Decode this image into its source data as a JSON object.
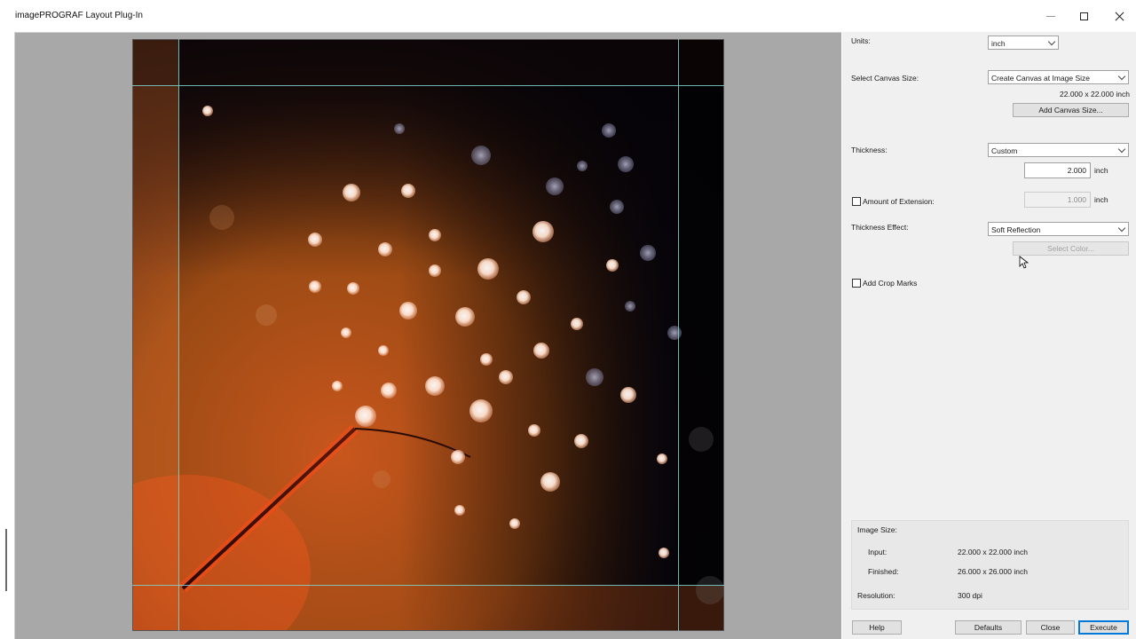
{
  "window": {
    "title": "imagePROGRAF Layout Plug-In"
  },
  "icons": {
    "minimize": "minimize-icon",
    "maximize": "maximize-icon",
    "close": "close-icon"
  },
  "panel": {
    "units": {
      "label": "Units:",
      "value": "inch"
    },
    "canvas_size": {
      "label": "Select Canvas Size:",
      "value": "Create Canvas at Image Size",
      "dimensions": "22.000 x 22.000 inch",
      "add_button": "Add Canvas Size..."
    },
    "thickness": {
      "label": "Thickness:",
      "value": "Custom",
      "amount": "2.000",
      "unit": "inch"
    },
    "extension": {
      "checkbox_label": "Amount of Extension:",
      "checked": false,
      "amount": "1.000",
      "unit": "inch"
    },
    "thickness_effect": {
      "label": "Thickness Effect:",
      "value": "Soft Reflection",
      "select_color_button": "Select Color..."
    },
    "crop_marks": {
      "checkbox_label": "Add Crop Marks",
      "checked": false
    },
    "image_size": {
      "title": "Image Size:",
      "input_label": "Input:",
      "input_value": "22.000 x 22.000 inch",
      "finished_label": "Finished:",
      "finished_value": "26.000 x 26.000 inch",
      "resolution_label": "Resolution:",
      "resolution_value": "300 dpi"
    },
    "buttons": {
      "help": "Help",
      "defaults": "Defaults",
      "close": "Close",
      "execute": "Execute"
    }
  },
  "colors": {
    "accent": "#0078d7",
    "guide": "#7fd4cf",
    "panel_bg": "#f0f0f0",
    "preview_bg": "#a8a8a8"
  }
}
